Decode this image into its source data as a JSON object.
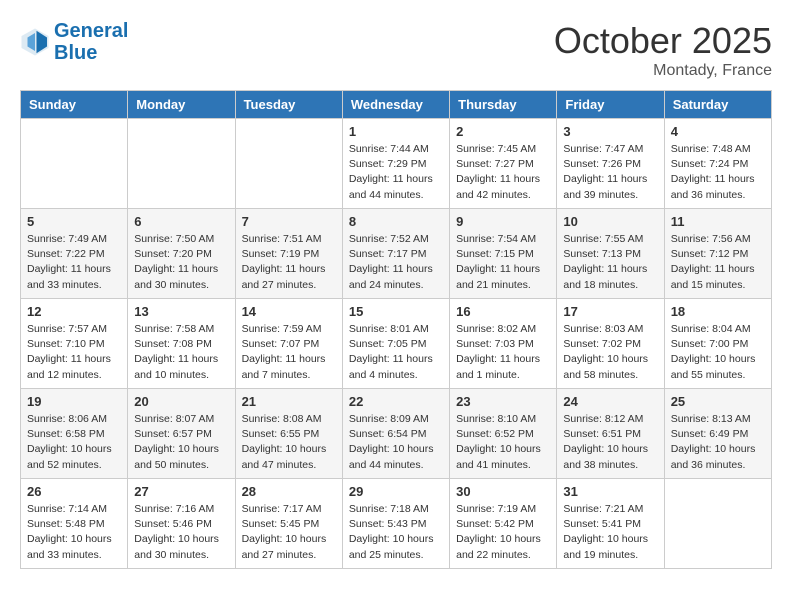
{
  "header": {
    "logo_line1": "General",
    "logo_line2": "Blue",
    "month": "October 2025",
    "location": "Montady, France"
  },
  "days_of_week": [
    "Sunday",
    "Monday",
    "Tuesday",
    "Wednesday",
    "Thursday",
    "Friday",
    "Saturday"
  ],
  "weeks": [
    [
      {
        "num": "",
        "info": ""
      },
      {
        "num": "",
        "info": ""
      },
      {
        "num": "",
        "info": ""
      },
      {
        "num": "1",
        "info": "Sunrise: 7:44 AM\nSunset: 7:29 PM\nDaylight: 11 hours and 44 minutes."
      },
      {
        "num": "2",
        "info": "Sunrise: 7:45 AM\nSunset: 7:27 PM\nDaylight: 11 hours and 42 minutes."
      },
      {
        "num": "3",
        "info": "Sunrise: 7:47 AM\nSunset: 7:26 PM\nDaylight: 11 hours and 39 minutes."
      },
      {
        "num": "4",
        "info": "Sunrise: 7:48 AM\nSunset: 7:24 PM\nDaylight: 11 hours and 36 minutes."
      }
    ],
    [
      {
        "num": "5",
        "info": "Sunrise: 7:49 AM\nSunset: 7:22 PM\nDaylight: 11 hours and 33 minutes."
      },
      {
        "num": "6",
        "info": "Sunrise: 7:50 AM\nSunset: 7:20 PM\nDaylight: 11 hours and 30 minutes."
      },
      {
        "num": "7",
        "info": "Sunrise: 7:51 AM\nSunset: 7:19 PM\nDaylight: 11 hours and 27 minutes."
      },
      {
        "num": "8",
        "info": "Sunrise: 7:52 AM\nSunset: 7:17 PM\nDaylight: 11 hours and 24 minutes."
      },
      {
        "num": "9",
        "info": "Sunrise: 7:54 AM\nSunset: 7:15 PM\nDaylight: 11 hours and 21 minutes."
      },
      {
        "num": "10",
        "info": "Sunrise: 7:55 AM\nSunset: 7:13 PM\nDaylight: 11 hours and 18 minutes."
      },
      {
        "num": "11",
        "info": "Sunrise: 7:56 AM\nSunset: 7:12 PM\nDaylight: 11 hours and 15 minutes."
      }
    ],
    [
      {
        "num": "12",
        "info": "Sunrise: 7:57 AM\nSunset: 7:10 PM\nDaylight: 11 hours and 12 minutes."
      },
      {
        "num": "13",
        "info": "Sunrise: 7:58 AM\nSunset: 7:08 PM\nDaylight: 11 hours and 10 minutes."
      },
      {
        "num": "14",
        "info": "Sunrise: 7:59 AM\nSunset: 7:07 PM\nDaylight: 11 hours and 7 minutes."
      },
      {
        "num": "15",
        "info": "Sunrise: 8:01 AM\nSunset: 7:05 PM\nDaylight: 11 hours and 4 minutes."
      },
      {
        "num": "16",
        "info": "Sunrise: 8:02 AM\nSunset: 7:03 PM\nDaylight: 11 hours and 1 minute."
      },
      {
        "num": "17",
        "info": "Sunrise: 8:03 AM\nSunset: 7:02 PM\nDaylight: 10 hours and 58 minutes."
      },
      {
        "num": "18",
        "info": "Sunrise: 8:04 AM\nSunset: 7:00 PM\nDaylight: 10 hours and 55 minutes."
      }
    ],
    [
      {
        "num": "19",
        "info": "Sunrise: 8:06 AM\nSunset: 6:58 PM\nDaylight: 10 hours and 52 minutes."
      },
      {
        "num": "20",
        "info": "Sunrise: 8:07 AM\nSunset: 6:57 PM\nDaylight: 10 hours and 50 minutes."
      },
      {
        "num": "21",
        "info": "Sunrise: 8:08 AM\nSunset: 6:55 PM\nDaylight: 10 hours and 47 minutes."
      },
      {
        "num": "22",
        "info": "Sunrise: 8:09 AM\nSunset: 6:54 PM\nDaylight: 10 hours and 44 minutes."
      },
      {
        "num": "23",
        "info": "Sunrise: 8:10 AM\nSunset: 6:52 PM\nDaylight: 10 hours and 41 minutes."
      },
      {
        "num": "24",
        "info": "Sunrise: 8:12 AM\nSunset: 6:51 PM\nDaylight: 10 hours and 38 minutes."
      },
      {
        "num": "25",
        "info": "Sunrise: 8:13 AM\nSunset: 6:49 PM\nDaylight: 10 hours and 36 minutes."
      }
    ],
    [
      {
        "num": "26",
        "info": "Sunrise: 7:14 AM\nSunset: 5:48 PM\nDaylight: 10 hours and 33 minutes."
      },
      {
        "num": "27",
        "info": "Sunrise: 7:16 AM\nSunset: 5:46 PM\nDaylight: 10 hours and 30 minutes."
      },
      {
        "num": "28",
        "info": "Sunrise: 7:17 AM\nSunset: 5:45 PM\nDaylight: 10 hours and 27 minutes."
      },
      {
        "num": "29",
        "info": "Sunrise: 7:18 AM\nSunset: 5:43 PM\nDaylight: 10 hours and 25 minutes."
      },
      {
        "num": "30",
        "info": "Sunrise: 7:19 AM\nSunset: 5:42 PM\nDaylight: 10 hours and 22 minutes."
      },
      {
        "num": "31",
        "info": "Sunrise: 7:21 AM\nSunset: 5:41 PM\nDaylight: 10 hours and 19 minutes."
      },
      {
        "num": "",
        "info": ""
      }
    ]
  ]
}
